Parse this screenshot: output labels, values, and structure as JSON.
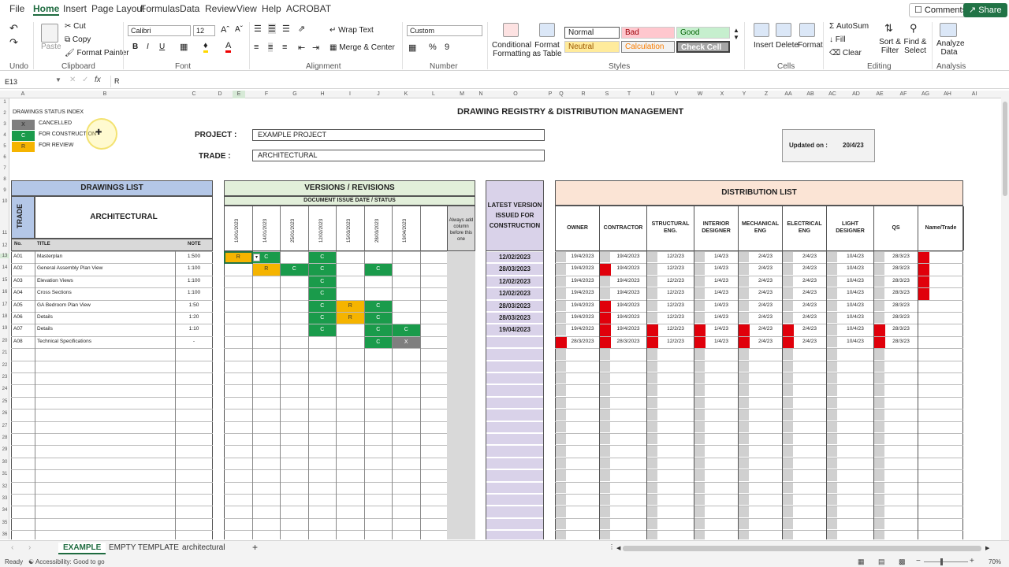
{
  "menu": {
    "items": [
      "File",
      "Home",
      "Insert",
      "Page Layout",
      "Formulas",
      "Data",
      "Review",
      "View",
      "Help",
      "ACROBAT"
    ],
    "active": "Home",
    "comments": "Comments",
    "share": "Share"
  },
  "ribbon": {
    "clipboard": {
      "paste": "Paste",
      "cut": "Cut",
      "copy": "Copy",
      "format_painter": "Format Painter",
      "group": "Clipboard"
    },
    "undo": {
      "group": "Undo"
    },
    "font": {
      "name": "Calibri",
      "size": "12",
      "bold": "B",
      "italic": "I",
      "underline": "U",
      "group": "Font"
    },
    "alignment": {
      "wrap": "Wrap Text",
      "merge": "Merge & Center",
      "group": "Alignment"
    },
    "number": {
      "format": "Custom",
      "percent": "%",
      "comma": "9",
      "group": "Number"
    },
    "styles": {
      "conditional": "Conditional Formatting",
      "format_table": "Format as Table",
      "normal": "Normal",
      "bad": "Bad",
      "good": "Good",
      "neutral": "Neutral",
      "calculation": "Calculation",
      "check_cell": "Check Cell",
      "group": "Styles"
    },
    "cells": {
      "insert": "Insert",
      "delete": "Delete",
      "format": "Format",
      "group": "Cells"
    },
    "editing": {
      "autosum": "AutoSum",
      "fill": "Fill",
      "clear": "Clear",
      "sort": "Sort & Filter",
      "find": "Find & Select",
      "group": "Editing"
    },
    "analysis": {
      "analyze": "Analyze Data",
      "group": "Analysis"
    }
  },
  "formula": {
    "namebox": "E13",
    "fx": "fx",
    "value": "R"
  },
  "columns": [
    "A",
    "B",
    "C",
    "D",
    "E",
    "F",
    "G",
    "H",
    "I",
    "J",
    "K",
    "L",
    "M",
    "N",
    "O",
    "P",
    "Q",
    "R",
    "S",
    "T",
    "U",
    "V",
    "W",
    "X",
    "Y",
    "Z",
    "AA",
    "AB",
    "AC",
    "AD",
    "AE",
    "AF",
    "AG",
    "AH",
    "AI"
  ],
  "sheet": {
    "title": "DRAWING REGISTRY & DISTRIBUTION MANAGEMENT",
    "index_title": "DRAWINGS STATUS INDEX",
    "index": [
      {
        "code": "X",
        "label": "CANCELLED"
      },
      {
        "code": "C",
        "label": "FOR CONSTRUCTION"
      },
      {
        "code": "R",
        "label": "FOR REVIEW"
      }
    ],
    "project_label": "PROJECT :",
    "project": "EXAMPLE PROJECT",
    "trade_label": "TRADE :",
    "trade": "ARCHITECTURAL",
    "updated_label": "Updated on :",
    "updated": "20/4/23",
    "drawings_list": "DRAWINGS LIST",
    "trade_vert": "TRADE",
    "trade_head": "ARCHITECTURAL",
    "no": "No.",
    "title_col": "TITLE",
    "note": "NOTE",
    "versions": "VERSIONS / REVISIONS",
    "issue": "DOCUMENT ISSUE DATE / STATUS",
    "dates": [
      "10/01/2023",
      "14/01/2023",
      "25/01/2023",
      "12/02/2023",
      "15/03/2023",
      "28/03/2023",
      "19/04/2023"
    ],
    "always_add": "Always add column before this one",
    "latest": "LATEST VERSION ISSUED FOR CONSTRUCTION",
    "distribution": "DISTRIBUTION LIST",
    "recipients": [
      "OWNER",
      "CONTRACTOR",
      "STRUCTURAL ENG.",
      "INTERIOR DESIGNER",
      "MECHANICAL ENG",
      "ELECTRICAL ENG",
      "LIGHT DESIGNER",
      "QS",
      "Name/Trade"
    ],
    "rows": [
      {
        "no": "A01",
        "title": "Masterplan",
        "note": "1:500",
        "status": [
          "R",
          "C",
          "",
          "C",
          "",
          "",
          ""
        ],
        "latest": "12/02/2023",
        "dist": [
          "19/4/2023",
          "19/4/2023",
          "12/2/23",
          "1/4/23",
          "2/4/23",
          "2/4/23",
          "10/4/23",
          "28/3/23"
        ]
      },
      {
        "no": "A02",
        "title": "General Assembly Plan View",
        "note": "1:100",
        "status": [
          "",
          "R",
          "C",
          "C",
          "",
          "C",
          ""
        ],
        "latest": "28/03/2023",
        "dist": [
          "19/4/2023",
          "19/4/2023",
          "12/2/23",
          "1/4/23",
          "2/4/23",
          "2/4/23",
          "10/4/23",
          "28/3/23"
        ]
      },
      {
        "no": "A03",
        "title": "Elevation Views",
        "note": "1:100",
        "status": [
          "",
          "",
          "",
          "C",
          "",
          "",
          ""
        ],
        "latest": "12/02/2023",
        "dist": [
          "19/4/2023",
          "19/4/2023",
          "12/2/23",
          "1/4/23",
          "2/4/23",
          "2/4/23",
          "10/4/23",
          "28/3/23"
        ]
      },
      {
        "no": "A04",
        "title": "Cross Sections",
        "note": "1:100",
        "status": [
          "",
          "",
          "",
          "C",
          "",
          "",
          ""
        ],
        "latest": "12/02/2023",
        "dist": [
          "19/4/2023",
          "19/4/2023",
          "12/2/23",
          "1/4/23",
          "2/4/23",
          "2/4/23",
          "10/4/23",
          "28/3/23"
        ]
      },
      {
        "no": "A05",
        "title": "GA Bedroom Plan View",
        "note": "1:50",
        "status": [
          "",
          "",
          "",
          "C",
          "R",
          "C",
          ""
        ],
        "latest": "28/03/2023",
        "dist": [
          "19/4/2023",
          "19/4/2023",
          "12/2/23",
          "1/4/23",
          "2/4/23",
          "2/4/23",
          "10/4/23",
          "28/3/23"
        ]
      },
      {
        "no": "A06",
        "title": "Details",
        "note": "1:20",
        "status": [
          "",
          "",
          "",
          "C",
          "R",
          "C",
          ""
        ],
        "latest": "28/03/2023",
        "dist": [
          "19/4/2023",
          "19/4/2023",
          "12/2/23",
          "1/4/23",
          "2/4/23",
          "2/4/23",
          "10/4/23",
          "28/3/23"
        ]
      },
      {
        "no": "A07",
        "title": "Details",
        "note": "1:10",
        "status": [
          "",
          "",
          "",
          "C",
          "",
          "C",
          "C"
        ],
        "latest": "19/04/2023",
        "dist": [
          "19/4/2023",
          "19/4/2023",
          "12/2/23",
          "1/4/23",
          "2/4/23",
          "2/4/23",
          "10/4/23",
          "28/3/23"
        ]
      },
      {
        "no": "A08",
        "title": "Technical Specifications",
        "note": "-",
        "status": [
          "",
          "",
          "",
          "",
          "",
          "C",
          "X"
        ],
        "latest": "",
        "dist": [
          "28/3/2023",
          "28/3/2023",
          "12/2/23",
          "1/4/23",
          "2/4/23",
          "2/4/23",
          "10/4/23",
          "28/3/23"
        ]
      }
    ],
    "red_flags": [
      [
        0,
        0,
        0,
        0,
        0,
        0,
        0,
        0,
        1
      ],
      [
        0,
        1,
        0,
        0,
        0,
        0,
        0,
        0,
        1
      ],
      [
        0,
        0,
        0,
        0,
        0,
        0,
        0,
        0,
        1
      ],
      [
        0,
        0,
        0,
        0,
        0,
        0,
        0,
        0,
        1
      ],
      [
        0,
        1,
        0,
        0,
        0,
        0,
        0,
        0,
        0
      ],
      [
        0,
        1,
        0,
        0,
        0,
        0,
        0,
        0,
        0
      ],
      [
        0,
        1,
        1,
        1,
        1,
        1,
        0,
        1,
        0
      ],
      [
        1,
        1,
        1,
        1,
        1,
        1,
        0,
        1,
        0
      ]
    ]
  },
  "tabs": [
    "EXAMPLE",
    "EMPTY TEMPLATE",
    "architectural"
  ],
  "active_tab": "EXAMPLE",
  "status": {
    "ready": "Ready",
    "accessibility": "Accessibility: Good to go",
    "zoom": "70%"
  },
  "colors": {
    "green": "#1a9b4b",
    "orange": "#f5b400",
    "gray": "#7f7f7f",
    "red": "#e0000b",
    "lilac": "#d9d2e9",
    "blue_head": "#b4c7e7",
    "peach": "#fbe4d5",
    "excel_green": "#217346"
  }
}
